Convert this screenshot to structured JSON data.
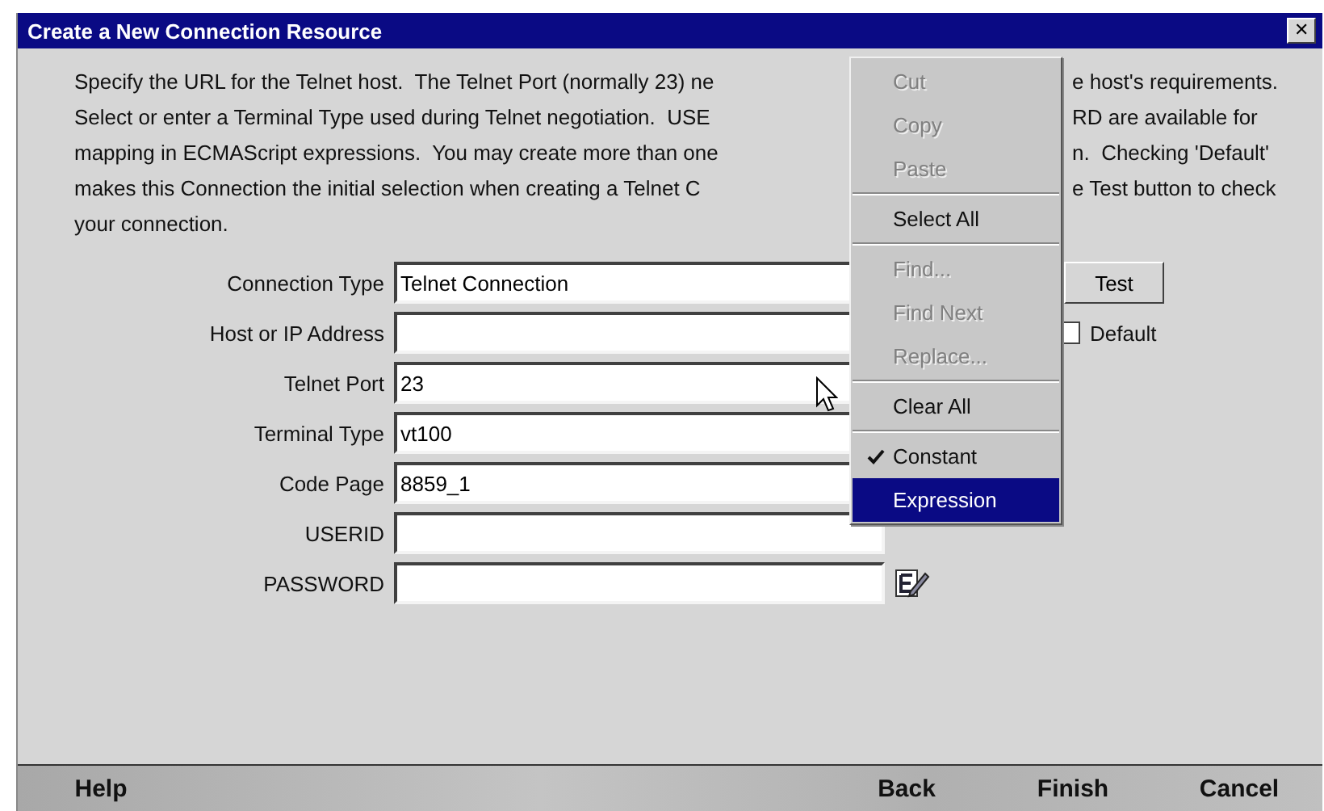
{
  "window": {
    "title": "Create a New Connection Resource",
    "close": "✕"
  },
  "description": {
    "lines": [
      {
        "left": "Specify the URL for the Telnet host.  The Telnet Port (normally 23) ne",
        "right": "e host's requirements."
      },
      {
        "left": "Select or enter a Terminal Type used during Telnet negotiation.  USE",
        "right": "RD are available for"
      },
      {
        "left": "mapping in ECMAScript expressions.  You may create more than one",
        "right": "n.  Checking 'Default'"
      },
      {
        "left": "makes this Connection the initial selection when creating a Telnet C",
        "right": "e Test button to check"
      },
      {
        "left": "your connection."
      }
    ]
  },
  "form": {
    "fields": [
      {
        "label": "Connection Type",
        "value": "Telnet Connection"
      },
      {
        "label": "Host or IP Address"
      },
      {
        "label": "Telnet Port",
        "value": "23"
      },
      {
        "label": "Terminal Type",
        "value": "vt100"
      },
      {
        "label": "Code Page",
        "value": "8859_1"
      },
      {
        "label": "USERID"
      },
      {
        "label": "PASSWORD"
      }
    ],
    "test_button": "Test",
    "default_checkbox": {
      "label": "Default",
      "checked": false
    }
  },
  "context_menu": {
    "items": [
      {
        "kind": "item",
        "label": "Cut",
        "disabled": true,
        "checked": false,
        "selected": false
      },
      {
        "kind": "item",
        "label": "Copy",
        "disabled": true,
        "checked": false,
        "selected": false
      },
      {
        "kind": "item",
        "label": "Paste",
        "disabled": true,
        "checked": false,
        "selected": false
      },
      {
        "kind": "separator"
      },
      {
        "kind": "item",
        "label": "Select All",
        "disabled": false,
        "checked": false,
        "selected": false
      },
      {
        "kind": "separator"
      },
      {
        "kind": "item",
        "label": "Find...",
        "disabled": true,
        "checked": false,
        "selected": false
      },
      {
        "kind": "item",
        "label": "Find Next",
        "disabled": true,
        "checked": false,
        "selected": false
      },
      {
        "kind": "item",
        "label": "Replace...",
        "disabled": true,
        "checked": false,
        "selected": false
      },
      {
        "kind": "separator"
      },
      {
        "kind": "item",
        "label": "Clear All",
        "disabled": false,
        "checked": false,
        "selected": false
      },
      {
        "kind": "separator"
      },
      {
        "kind": "item",
        "label": "Constant",
        "disabled": false,
        "checked": true,
        "selected": false
      },
      {
        "kind": "item",
        "label": "Expression",
        "disabled": false,
        "checked": false,
        "selected": true
      }
    ]
  },
  "footer": {
    "left_buttons": [
      "Help"
    ],
    "right_buttons": [
      "Back",
      "Finish",
      "Cancel"
    ]
  }
}
